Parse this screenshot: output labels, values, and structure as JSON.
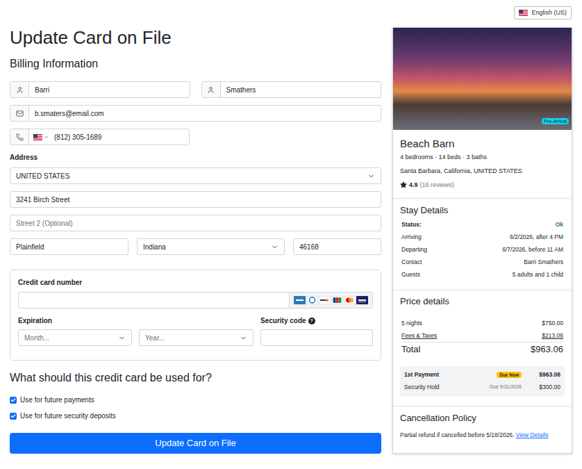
{
  "language": {
    "label": "English (US)"
  },
  "title": "Update Card on File",
  "billing": {
    "heading": "Billing Information",
    "first_name": "Barri",
    "last_name": "Smathers",
    "email": "b.smaters@email.com",
    "phone": "(812) 305-1689"
  },
  "address": {
    "label": "Address",
    "country": "UNITED STATES",
    "street": "3241 Birch Street",
    "street2_placeholder": "Street 2 (Optional)",
    "city": "Plainfield",
    "state": "Indiana",
    "zip": "46168"
  },
  "card": {
    "number_label": "Credit card number",
    "number": "",
    "expiration_label": "Expiration",
    "month_placeholder": "Month...",
    "year_placeholder": "Year...",
    "security_label": "Security code",
    "help": "?",
    "security_code": ""
  },
  "usage": {
    "heading": "What should this credit card be used for?",
    "options": [
      {
        "label": "Use for future payments",
        "checked": true
      },
      {
        "label": "Use for future security deposits",
        "checked": true
      }
    ]
  },
  "submit": "Update Card on File",
  "property": {
    "badge": "Pre-Arrival",
    "name": "Beach Barn",
    "details": "4 bedrooms · 14 beds · 3 baths",
    "location": "Santa Barbara, California, UNITED STATES",
    "rating": "4.9",
    "reviews": "(16 reviews)"
  },
  "stay": {
    "heading": "Stay Details",
    "rows": [
      {
        "label": "Status:",
        "value": "Ok",
        "kind": "status"
      },
      {
        "label": "Arriving",
        "value": "6/2/2026, after 4 PM",
        "kind": "plain"
      },
      {
        "label": "Departing",
        "value": "6/7/2026, before 11 AM",
        "kind": "plain"
      },
      {
        "label": "Contact",
        "value": "Barri Smathers",
        "kind": "plain"
      },
      {
        "label": "Guests",
        "value": "5 adults and 1 child",
        "kind": "plain"
      }
    ]
  },
  "price": {
    "heading": "Price details",
    "rows": [
      {
        "label": "5 nights",
        "value": "$750.00",
        "kind": "plain"
      },
      {
        "label": "Fees & Taxes",
        "value": "$213.06",
        "kind": "link"
      }
    ],
    "total_label": "Total",
    "total": "$963.06",
    "payments": [
      {
        "label": "1st Payment",
        "badge": "Due Now",
        "due": "",
        "amount": "$963.06",
        "kind": "due-now"
      },
      {
        "label": "Security Hold",
        "badge": "",
        "due": "Due 5/31/2026",
        "amount": "$300.00",
        "kind": "scheduled"
      }
    ]
  },
  "cancellation": {
    "heading": "Cancellation Policy",
    "text": "Partial refund if cancelled before 5/18/2026.",
    "link": "View Details"
  }
}
